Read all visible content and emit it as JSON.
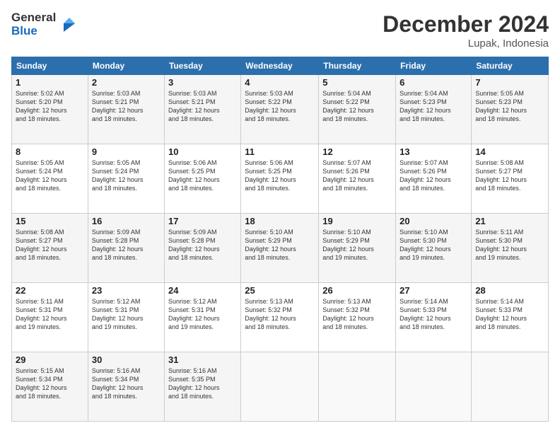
{
  "logo": {
    "text_general": "General",
    "text_blue": "Blue"
  },
  "header": {
    "month": "December 2024",
    "location": "Lupak, Indonesia"
  },
  "weekdays": [
    "Sunday",
    "Monday",
    "Tuesday",
    "Wednesday",
    "Thursday",
    "Friday",
    "Saturday"
  ],
  "rows": [
    [
      {
        "day": "1",
        "info": "Sunrise: 5:02 AM\nSunset: 5:20 PM\nDaylight: 12 hours\nand 18 minutes."
      },
      {
        "day": "2",
        "info": "Sunrise: 5:03 AM\nSunset: 5:21 PM\nDaylight: 12 hours\nand 18 minutes."
      },
      {
        "day": "3",
        "info": "Sunrise: 5:03 AM\nSunset: 5:21 PM\nDaylight: 12 hours\nand 18 minutes."
      },
      {
        "day": "4",
        "info": "Sunrise: 5:03 AM\nSunset: 5:22 PM\nDaylight: 12 hours\nand 18 minutes."
      },
      {
        "day": "5",
        "info": "Sunrise: 5:04 AM\nSunset: 5:22 PM\nDaylight: 12 hours\nand 18 minutes."
      },
      {
        "day": "6",
        "info": "Sunrise: 5:04 AM\nSunset: 5:23 PM\nDaylight: 12 hours\nand 18 minutes."
      },
      {
        "day": "7",
        "info": "Sunrise: 5:05 AM\nSunset: 5:23 PM\nDaylight: 12 hours\nand 18 minutes."
      }
    ],
    [
      {
        "day": "8",
        "info": "Sunrise: 5:05 AM\nSunset: 5:24 PM\nDaylight: 12 hours\nand 18 minutes."
      },
      {
        "day": "9",
        "info": "Sunrise: 5:05 AM\nSunset: 5:24 PM\nDaylight: 12 hours\nand 18 minutes."
      },
      {
        "day": "10",
        "info": "Sunrise: 5:06 AM\nSunset: 5:25 PM\nDaylight: 12 hours\nand 18 minutes."
      },
      {
        "day": "11",
        "info": "Sunrise: 5:06 AM\nSunset: 5:25 PM\nDaylight: 12 hours\nand 18 minutes."
      },
      {
        "day": "12",
        "info": "Sunrise: 5:07 AM\nSunset: 5:26 PM\nDaylight: 12 hours\nand 18 minutes."
      },
      {
        "day": "13",
        "info": "Sunrise: 5:07 AM\nSunset: 5:26 PM\nDaylight: 12 hours\nand 18 minutes."
      },
      {
        "day": "14",
        "info": "Sunrise: 5:08 AM\nSunset: 5:27 PM\nDaylight: 12 hours\nand 18 minutes."
      }
    ],
    [
      {
        "day": "15",
        "info": "Sunrise: 5:08 AM\nSunset: 5:27 PM\nDaylight: 12 hours\nand 18 minutes."
      },
      {
        "day": "16",
        "info": "Sunrise: 5:09 AM\nSunset: 5:28 PM\nDaylight: 12 hours\nand 18 minutes."
      },
      {
        "day": "17",
        "info": "Sunrise: 5:09 AM\nSunset: 5:28 PM\nDaylight: 12 hours\nand 18 minutes."
      },
      {
        "day": "18",
        "info": "Sunrise: 5:10 AM\nSunset: 5:29 PM\nDaylight: 12 hours\nand 18 minutes."
      },
      {
        "day": "19",
        "info": "Sunrise: 5:10 AM\nSunset: 5:29 PM\nDaylight: 12 hours\nand 19 minutes."
      },
      {
        "day": "20",
        "info": "Sunrise: 5:10 AM\nSunset: 5:30 PM\nDaylight: 12 hours\nand 19 minutes."
      },
      {
        "day": "21",
        "info": "Sunrise: 5:11 AM\nSunset: 5:30 PM\nDaylight: 12 hours\nand 19 minutes."
      }
    ],
    [
      {
        "day": "22",
        "info": "Sunrise: 5:11 AM\nSunset: 5:31 PM\nDaylight: 12 hours\nand 19 minutes."
      },
      {
        "day": "23",
        "info": "Sunrise: 5:12 AM\nSunset: 5:31 PM\nDaylight: 12 hours\nand 19 minutes."
      },
      {
        "day": "24",
        "info": "Sunrise: 5:12 AM\nSunset: 5:31 PM\nDaylight: 12 hours\nand 19 minutes."
      },
      {
        "day": "25",
        "info": "Sunrise: 5:13 AM\nSunset: 5:32 PM\nDaylight: 12 hours\nand 18 minutes."
      },
      {
        "day": "26",
        "info": "Sunrise: 5:13 AM\nSunset: 5:32 PM\nDaylight: 12 hours\nand 18 minutes."
      },
      {
        "day": "27",
        "info": "Sunrise: 5:14 AM\nSunset: 5:33 PM\nDaylight: 12 hours\nand 18 minutes."
      },
      {
        "day": "28",
        "info": "Sunrise: 5:14 AM\nSunset: 5:33 PM\nDaylight: 12 hours\nand 18 minutes."
      }
    ],
    [
      {
        "day": "29",
        "info": "Sunrise: 5:15 AM\nSunset: 5:34 PM\nDaylight: 12 hours\nand 18 minutes."
      },
      {
        "day": "30",
        "info": "Sunrise: 5:16 AM\nSunset: 5:34 PM\nDaylight: 12 hours\nand 18 minutes."
      },
      {
        "day": "31",
        "info": "Sunrise: 5:16 AM\nSunset: 5:35 PM\nDaylight: 12 hours\nand 18 minutes."
      },
      {
        "day": "",
        "info": ""
      },
      {
        "day": "",
        "info": ""
      },
      {
        "day": "",
        "info": ""
      },
      {
        "day": "",
        "info": ""
      }
    ]
  ]
}
